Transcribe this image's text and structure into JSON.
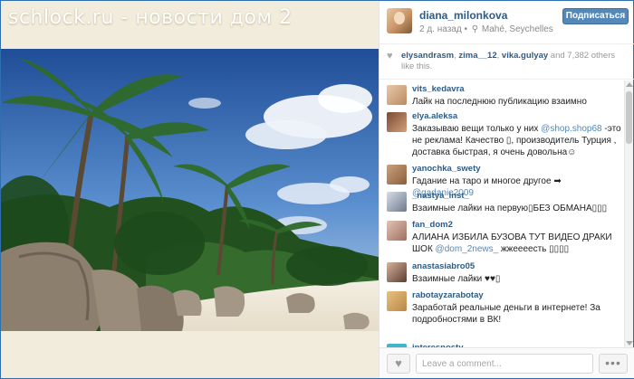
{
  "watermark": "schlock.ru - новости дом 2",
  "post": {
    "username": "diana_milonkovа",
    "time": "2 д. назад",
    "location": "Mahé, Seychelles",
    "follow_label": "Подписаться"
  },
  "likes": {
    "user1": "elysandrasm",
    "user2": "zima__12",
    "user3": "vika.gulyay",
    "rest": "and 7,382 others like this."
  },
  "comments": [
    {
      "user": "vits_kedavra",
      "text": "Лайк на последнюю публикацию взаимно",
      "mention": ""
    },
    {
      "user": "elya.aleksa",
      "text": "Заказываю вещи только у них ",
      "mention": "@shop.shop68",
      "text2": " -это не реклама! Качество ▯, производитель Турция , доставка быстрая, я очень довольна☺"
    },
    {
      "user": "yanochka_swety",
      "text": "Гадание на таро и многое другое ➡ ",
      "mention": "@gadanie2009",
      "text2": ""
    },
    {
      "user": "_nastya_inst_",
      "text": "Взаимные лайки на первую▯БЕЗ ОБМАНА▯▯▯",
      "mention": "",
      "text2": ""
    },
    {
      "user": "fan_dom2",
      "text": "АЛИАНА ИЗБИЛА БУЗОВА ТУТ ВИДЕО ДРАКИ ШОК ",
      "mention": "@dom_2news_",
      "text2": " жжеееесть ▯▯▯▯"
    },
    {
      "user": "anastasiabro05",
      "text": "Взаимные лайки ♥♥▯",
      "mention": "",
      "text2": ""
    },
    {
      "user": "rabotayzarabotay",
      "text": "Заработай реальные деньги в интернете! За подробностями в ВК!",
      "mention": "",
      "text2": ""
    },
    {
      "user": "interesnosty",
      "text": "",
      "mention": "",
      "text2": ""
    }
  ],
  "input": {
    "placeholder": "Leave a comment..."
  },
  "more_label": "•••",
  "colors": {
    "link": "#2d5b86",
    "button": "#5488b8",
    "frame": "#2f6fb0"
  }
}
